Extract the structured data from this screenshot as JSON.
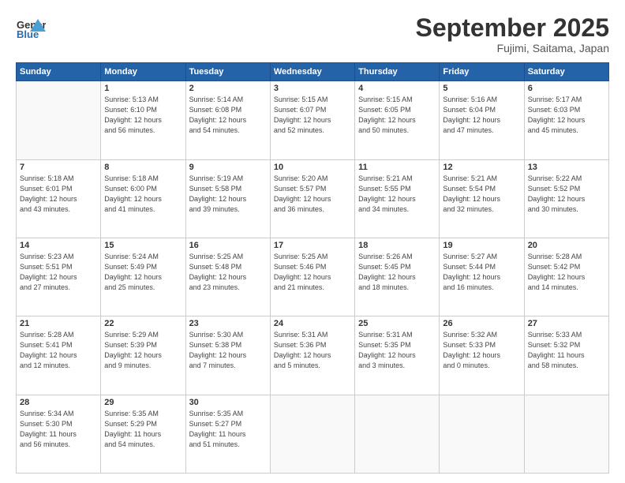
{
  "header": {
    "logo_general": "General",
    "logo_blue": "Blue",
    "month": "September 2025",
    "location": "Fujimi, Saitama, Japan"
  },
  "weekdays": [
    "Sunday",
    "Monday",
    "Tuesday",
    "Wednesday",
    "Thursday",
    "Friday",
    "Saturday"
  ],
  "weeks": [
    [
      {
        "day": "",
        "info": ""
      },
      {
        "day": "1",
        "info": "Sunrise: 5:13 AM\nSunset: 6:10 PM\nDaylight: 12 hours\nand 56 minutes."
      },
      {
        "day": "2",
        "info": "Sunrise: 5:14 AM\nSunset: 6:08 PM\nDaylight: 12 hours\nand 54 minutes."
      },
      {
        "day": "3",
        "info": "Sunrise: 5:15 AM\nSunset: 6:07 PM\nDaylight: 12 hours\nand 52 minutes."
      },
      {
        "day": "4",
        "info": "Sunrise: 5:15 AM\nSunset: 6:05 PM\nDaylight: 12 hours\nand 50 minutes."
      },
      {
        "day": "5",
        "info": "Sunrise: 5:16 AM\nSunset: 6:04 PM\nDaylight: 12 hours\nand 47 minutes."
      },
      {
        "day": "6",
        "info": "Sunrise: 5:17 AM\nSunset: 6:03 PM\nDaylight: 12 hours\nand 45 minutes."
      }
    ],
    [
      {
        "day": "7",
        "info": "Sunrise: 5:18 AM\nSunset: 6:01 PM\nDaylight: 12 hours\nand 43 minutes."
      },
      {
        "day": "8",
        "info": "Sunrise: 5:18 AM\nSunset: 6:00 PM\nDaylight: 12 hours\nand 41 minutes."
      },
      {
        "day": "9",
        "info": "Sunrise: 5:19 AM\nSunset: 5:58 PM\nDaylight: 12 hours\nand 39 minutes."
      },
      {
        "day": "10",
        "info": "Sunrise: 5:20 AM\nSunset: 5:57 PM\nDaylight: 12 hours\nand 36 minutes."
      },
      {
        "day": "11",
        "info": "Sunrise: 5:21 AM\nSunset: 5:55 PM\nDaylight: 12 hours\nand 34 minutes."
      },
      {
        "day": "12",
        "info": "Sunrise: 5:21 AM\nSunset: 5:54 PM\nDaylight: 12 hours\nand 32 minutes."
      },
      {
        "day": "13",
        "info": "Sunrise: 5:22 AM\nSunset: 5:52 PM\nDaylight: 12 hours\nand 30 minutes."
      }
    ],
    [
      {
        "day": "14",
        "info": "Sunrise: 5:23 AM\nSunset: 5:51 PM\nDaylight: 12 hours\nand 27 minutes."
      },
      {
        "day": "15",
        "info": "Sunrise: 5:24 AM\nSunset: 5:49 PM\nDaylight: 12 hours\nand 25 minutes."
      },
      {
        "day": "16",
        "info": "Sunrise: 5:25 AM\nSunset: 5:48 PM\nDaylight: 12 hours\nand 23 minutes."
      },
      {
        "day": "17",
        "info": "Sunrise: 5:25 AM\nSunset: 5:46 PM\nDaylight: 12 hours\nand 21 minutes."
      },
      {
        "day": "18",
        "info": "Sunrise: 5:26 AM\nSunset: 5:45 PM\nDaylight: 12 hours\nand 18 minutes."
      },
      {
        "day": "19",
        "info": "Sunrise: 5:27 AM\nSunset: 5:44 PM\nDaylight: 12 hours\nand 16 minutes."
      },
      {
        "day": "20",
        "info": "Sunrise: 5:28 AM\nSunset: 5:42 PM\nDaylight: 12 hours\nand 14 minutes."
      }
    ],
    [
      {
        "day": "21",
        "info": "Sunrise: 5:28 AM\nSunset: 5:41 PM\nDaylight: 12 hours\nand 12 minutes."
      },
      {
        "day": "22",
        "info": "Sunrise: 5:29 AM\nSunset: 5:39 PM\nDaylight: 12 hours\nand 9 minutes."
      },
      {
        "day": "23",
        "info": "Sunrise: 5:30 AM\nSunset: 5:38 PM\nDaylight: 12 hours\nand 7 minutes."
      },
      {
        "day": "24",
        "info": "Sunrise: 5:31 AM\nSunset: 5:36 PM\nDaylight: 12 hours\nand 5 minutes."
      },
      {
        "day": "25",
        "info": "Sunrise: 5:31 AM\nSunset: 5:35 PM\nDaylight: 12 hours\nand 3 minutes."
      },
      {
        "day": "26",
        "info": "Sunrise: 5:32 AM\nSunset: 5:33 PM\nDaylight: 12 hours\nand 0 minutes."
      },
      {
        "day": "27",
        "info": "Sunrise: 5:33 AM\nSunset: 5:32 PM\nDaylight: 11 hours\nand 58 minutes."
      }
    ],
    [
      {
        "day": "28",
        "info": "Sunrise: 5:34 AM\nSunset: 5:30 PM\nDaylight: 11 hours\nand 56 minutes."
      },
      {
        "day": "29",
        "info": "Sunrise: 5:35 AM\nSunset: 5:29 PM\nDaylight: 11 hours\nand 54 minutes."
      },
      {
        "day": "30",
        "info": "Sunrise: 5:35 AM\nSunset: 5:27 PM\nDaylight: 11 hours\nand 51 minutes."
      },
      {
        "day": "",
        "info": ""
      },
      {
        "day": "",
        "info": ""
      },
      {
        "day": "",
        "info": ""
      },
      {
        "day": "",
        "info": ""
      }
    ]
  ]
}
